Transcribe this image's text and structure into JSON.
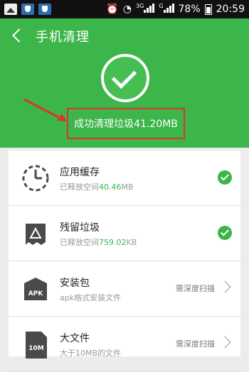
{
  "status_bar": {
    "net_3g": "3G",
    "net_g": "G",
    "battery": "78%",
    "time": "20:59"
  },
  "header": {
    "title": "手机清理",
    "result_text": "成功清理垃圾41.20MB"
  },
  "items": [
    {
      "title": "应用缓存",
      "sub_prefix": "已释放空间",
      "sub_value": "40.46",
      "sub_unit": "MB",
      "status": "done"
    },
    {
      "title": "残留垃圾",
      "sub_prefix": "已释放空间",
      "sub_value": "759.02",
      "sub_unit": "KB",
      "status": "done"
    },
    {
      "title": "安装包",
      "sub_prefix": "apk格式安装文件",
      "action": "需深度扫描"
    },
    {
      "title": "大文件",
      "sub_prefix": "大于10MB的文件",
      "action": "需深度扫描"
    }
  ],
  "icon_labels": {
    "apk": "APK",
    "ten_m": "10M"
  },
  "colors": {
    "accent_green": "#3cb54a",
    "highlight_red": "#d9362c"
  }
}
